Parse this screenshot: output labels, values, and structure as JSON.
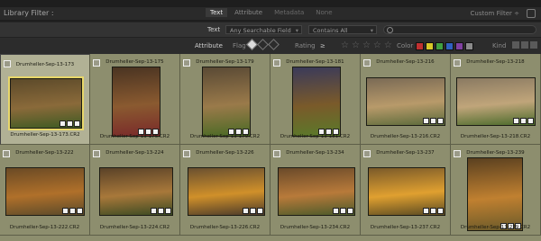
{
  "filter_bar": {
    "title": "Library Filter :",
    "tabs": [
      {
        "label": "Text",
        "state": "active"
      },
      {
        "label": "Attribute",
        "state": "normal"
      },
      {
        "label": "Metadata",
        "state": "dim"
      },
      {
        "label": "None",
        "state": "dim"
      }
    ],
    "custom_filter": "Custom Filter ÷"
  },
  "text_row": {
    "label": "Text",
    "field_select": "Any Searchable Field",
    "rule_select": "Contains All",
    "search_placeholder": ""
  },
  "attribute_row": {
    "label": "Attribute",
    "flag_label": "Flag",
    "rating_label": "Rating",
    "rating_op": "≥",
    "color_label": "Color",
    "kind_label": "Kind",
    "colors": [
      "#c03030",
      "#d8c828",
      "#40a040",
      "#3060c0",
      "#8040a0",
      "#8a8a8a"
    ]
  },
  "grid": {
    "cells": [
      {
        "num": "",
        "file": "Drumheller-Sep-13-173.CR2",
        "title_label": "Drumheller-Sep-13-173",
        "selected": true
      },
      {
        "num": "",
        "file": "Drumheller-Sep-13-175.CR2",
        "title_label": "Drumheller-Sep-13-175",
        "selected": false
      },
      {
        "num": "",
        "file": "Drumheller-Sep-13-179.CR2",
        "title_label": "Drumheller-Sep-13-179",
        "selected": false
      },
      {
        "num": "",
        "file": "Drumheller-Sep-13-181.CR2",
        "title_label": "Drumheller-Sep-13-181",
        "selected": false
      },
      {
        "num": "",
        "file": "Drumheller-Sep-13-216.CR2",
        "title_label": "Drumheller-Sep-13-216",
        "selected": false
      },
      {
        "num": "",
        "file": "Drumheller-Sep-13-218.CR2",
        "title_label": "Drumheller-Sep-13-218",
        "selected": false
      },
      {
        "num": "",
        "file": "Drumheller-Sep-13-222.CR2",
        "title_label": "Drumheller-Sep-13-222",
        "selected": false
      },
      {
        "num": "",
        "file": "Drumheller-Sep-13-224.CR2",
        "title_label": "Drumheller-Sep-13-224",
        "selected": false
      },
      {
        "num": "",
        "file": "Drumheller-Sep-13-226.CR2",
        "title_label": "Drumheller-Sep-13-226",
        "selected": false
      },
      {
        "num": "",
        "file": "Drumheller-Sep-13-234.CR2",
        "title_label": "Drumheller-Sep-13-234",
        "selected": false
      },
      {
        "num": "",
        "file": "Drumheller-Sep-13-237.CR2",
        "title_label": "Drumheller-Sep-13-237",
        "selected": false
      },
      {
        "num": "",
        "file": "Drumheller-Sep-13-239.CR2",
        "title_label": "Drumheller-Sep-13-239",
        "selected": false
      }
    ]
  }
}
